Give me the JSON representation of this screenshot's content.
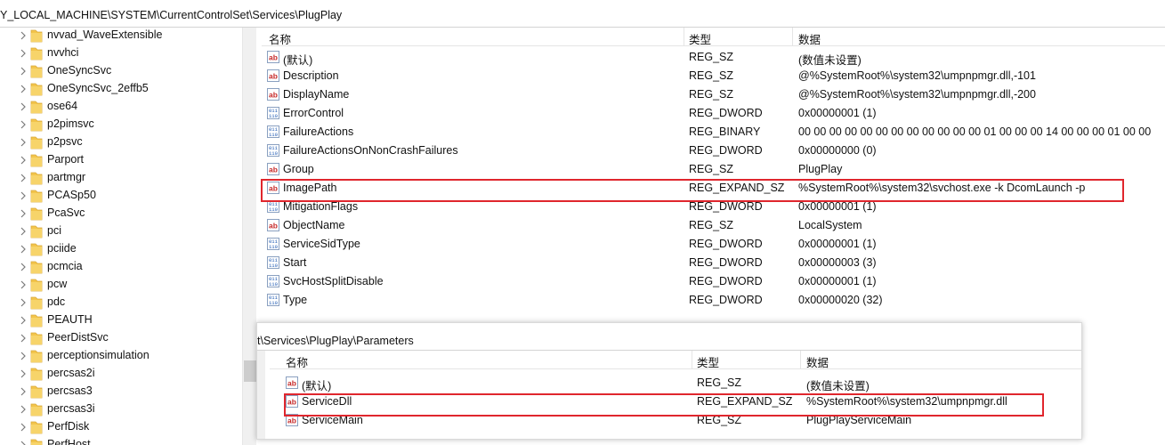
{
  "address_bar": {
    "path": "Y_LOCAL_MACHINE\\SYSTEM\\CurrentControlSet\\Services\\PlugPlay"
  },
  "tree": {
    "items": [
      {
        "label": "nvvad_WaveExtensible"
      },
      {
        "label": "nvvhci"
      },
      {
        "label": "OneSyncSvc"
      },
      {
        "label": "OneSyncSvc_2effb5"
      },
      {
        "label": "ose64"
      },
      {
        "label": "p2pimsvc"
      },
      {
        "label": "p2psvc"
      },
      {
        "label": "Parport"
      },
      {
        "label": "partmgr"
      },
      {
        "label": "PCASp50"
      },
      {
        "label": "PcaSvc"
      },
      {
        "label": "pci"
      },
      {
        "label": "pciide"
      },
      {
        "label": "pcmcia"
      },
      {
        "label": "pcw"
      },
      {
        "label": "pdc"
      },
      {
        "label": "PEAUTH"
      },
      {
        "label": "PeerDistSvc"
      },
      {
        "label": "perceptionsimulation"
      },
      {
        "label": "percsas2i"
      },
      {
        "label": "percsas3"
      },
      {
        "label": "percsas3i"
      },
      {
        "label": "PerfDisk"
      },
      {
        "label": "PerfHost"
      }
    ]
  },
  "values_list": {
    "columns": {
      "name": "名称",
      "type": "类型",
      "data": "数据"
    },
    "rows": [
      {
        "icon": "string-value-icon",
        "name": "(默认)",
        "type": "REG_SZ",
        "data": "(数值未设置)"
      },
      {
        "icon": "string-value-icon",
        "name": "Description",
        "type": "REG_SZ",
        "data": "@%SystemRoot%\\system32\\umpnpmgr.dll,-101"
      },
      {
        "icon": "string-value-icon",
        "name": "DisplayName",
        "type": "REG_SZ",
        "data": "@%SystemRoot%\\system32\\umpnpmgr.dll,-200"
      },
      {
        "icon": "binary-value-icon",
        "name": "ErrorControl",
        "type": "REG_DWORD",
        "data": "0x00000001 (1)"
      },
      {
        "icon": "binary-value-icon",
        "name": "FailureActions",
        "type": "REG_BINARY",
        "data": "00 00 00 00 00 00 00 00 00 00 00 00 01 00 00 00 14 00 00 00 01 00 00"
      },
      {
        "icon": "binary-value-icon",
        "name": "FailureActionsOnNonCrashFailures",
        "type": "REG_DWORD",
        "data": "0x00000000 (0)"
      },
      {
        "icon": "string-value-icon",
        "name": "Group",
        "type": "REG_SZ",
        "data": "PlugPlay"
      },
      {
        "icon": "string-value-icon",
        "name": "ImagePath",
        "type": "REG_EXPAND_SZ",
        "data": "%SystemRoot%\\system32\\svchost.exe -k DcomLaunch -p"
      },
      {
        "icon": "binary-value-icon",
        "name": "MitigationFlags",
        "type": "REG_DWORD",
        "data": "0x00000001 (1)"
      },
      {
        "icon": "string-value-icon",
        "name": "ObjectName",
        "type": "REG_SZ",
        "data": "LocalSystem"
      },
      {
        "icon": "binary-value-icon",
        "name": "ServiceSidType",
        "type": "REG_DWORD",
        "data": "0x00000001 (1)"
      },
      {
        "icon": "binary-value-icon",
        "name": "Start",
        "type": "REG_DWORD",
        "data": "0x00000003 (3)"
      },
      {
        "icon": "binary-value-icon",
        "name": "SvcHostSplitDisable",
        "type": "REG_DWORD",
        "data": "0x00000001 (1)"
      },
      {
        "icon": "binary-value-icon",
        "name": "Type",
        "type": "REG_DWORD",
        "data": "0x00000020 (32)"
      }
    ]
  },
  "parameters_panel": {
    "address": "t\\Services\\PlugPlay\\Parameters",
    "columns": {
      "name": "名称",
      "type": "类型",
      "data": "数据"
    },
    "rows": [
      {
        "icon": "string-value-icon",
        "name": "(默认)",
        "type": "REG_SZ",
        "data": "(数值未设置)"
      },
      {
        "icon": "string-value-icon",
        "name": "ServiceDll",
        "type": "REG_EXPAND_SZ",
        "data": "%SystemRoot%\\system32\\umpnpmgr.dll"
      },
      {
        "icon": "string-value-icon",
        "name": "ServiceMain",
        "type": "REG_SZ",
        "data": "PlugPlayServiceMain"
      }
    ]
  },
  "colors": {
    "highlight": "#e0262d",
    "folder": "#f3c54c",
    "string_icon": "#c62828",
    "binary_icon": "#1e5ab4"
  }
}
